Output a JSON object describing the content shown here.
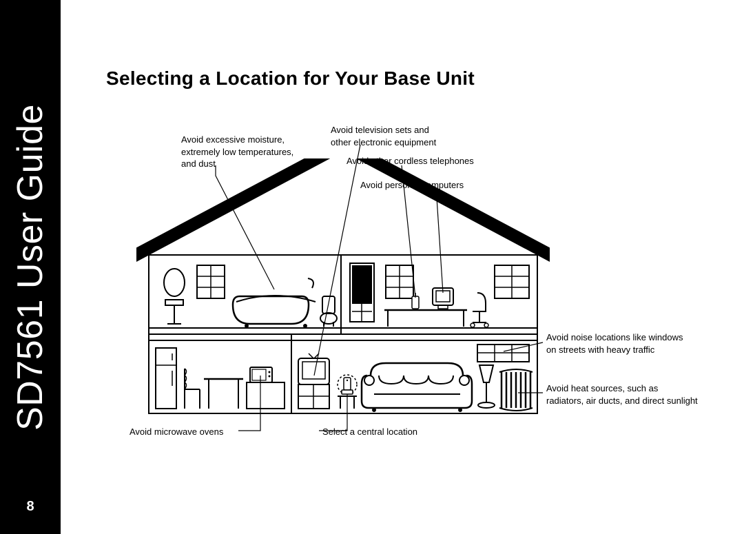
{
  "sidebar": {
    "title": "SD7561 User Guide"
  },
  "page_number": "8",
  "heading": "Selecting a Location for Your Base Unit",
  "annotations": {
    "moisture": "Avoid excessive moisture,\nextremely low temperatures,\nand dust",
    "tv": "Avoid television sets and\nother electronic equipment",
    "cordless": "Avoid other cordless telephones",
    "pc": "Avoid personal computers",
    "noise": "Avoid noise locations like windows\non streets with heavy traffic",
    "heat": "Avoid heat sources, such as\nradiators, air ducts, and direct sunlight",
    "microwave": "Avoid microwave ovens",
    "central": "Select a central location"
  }
}
